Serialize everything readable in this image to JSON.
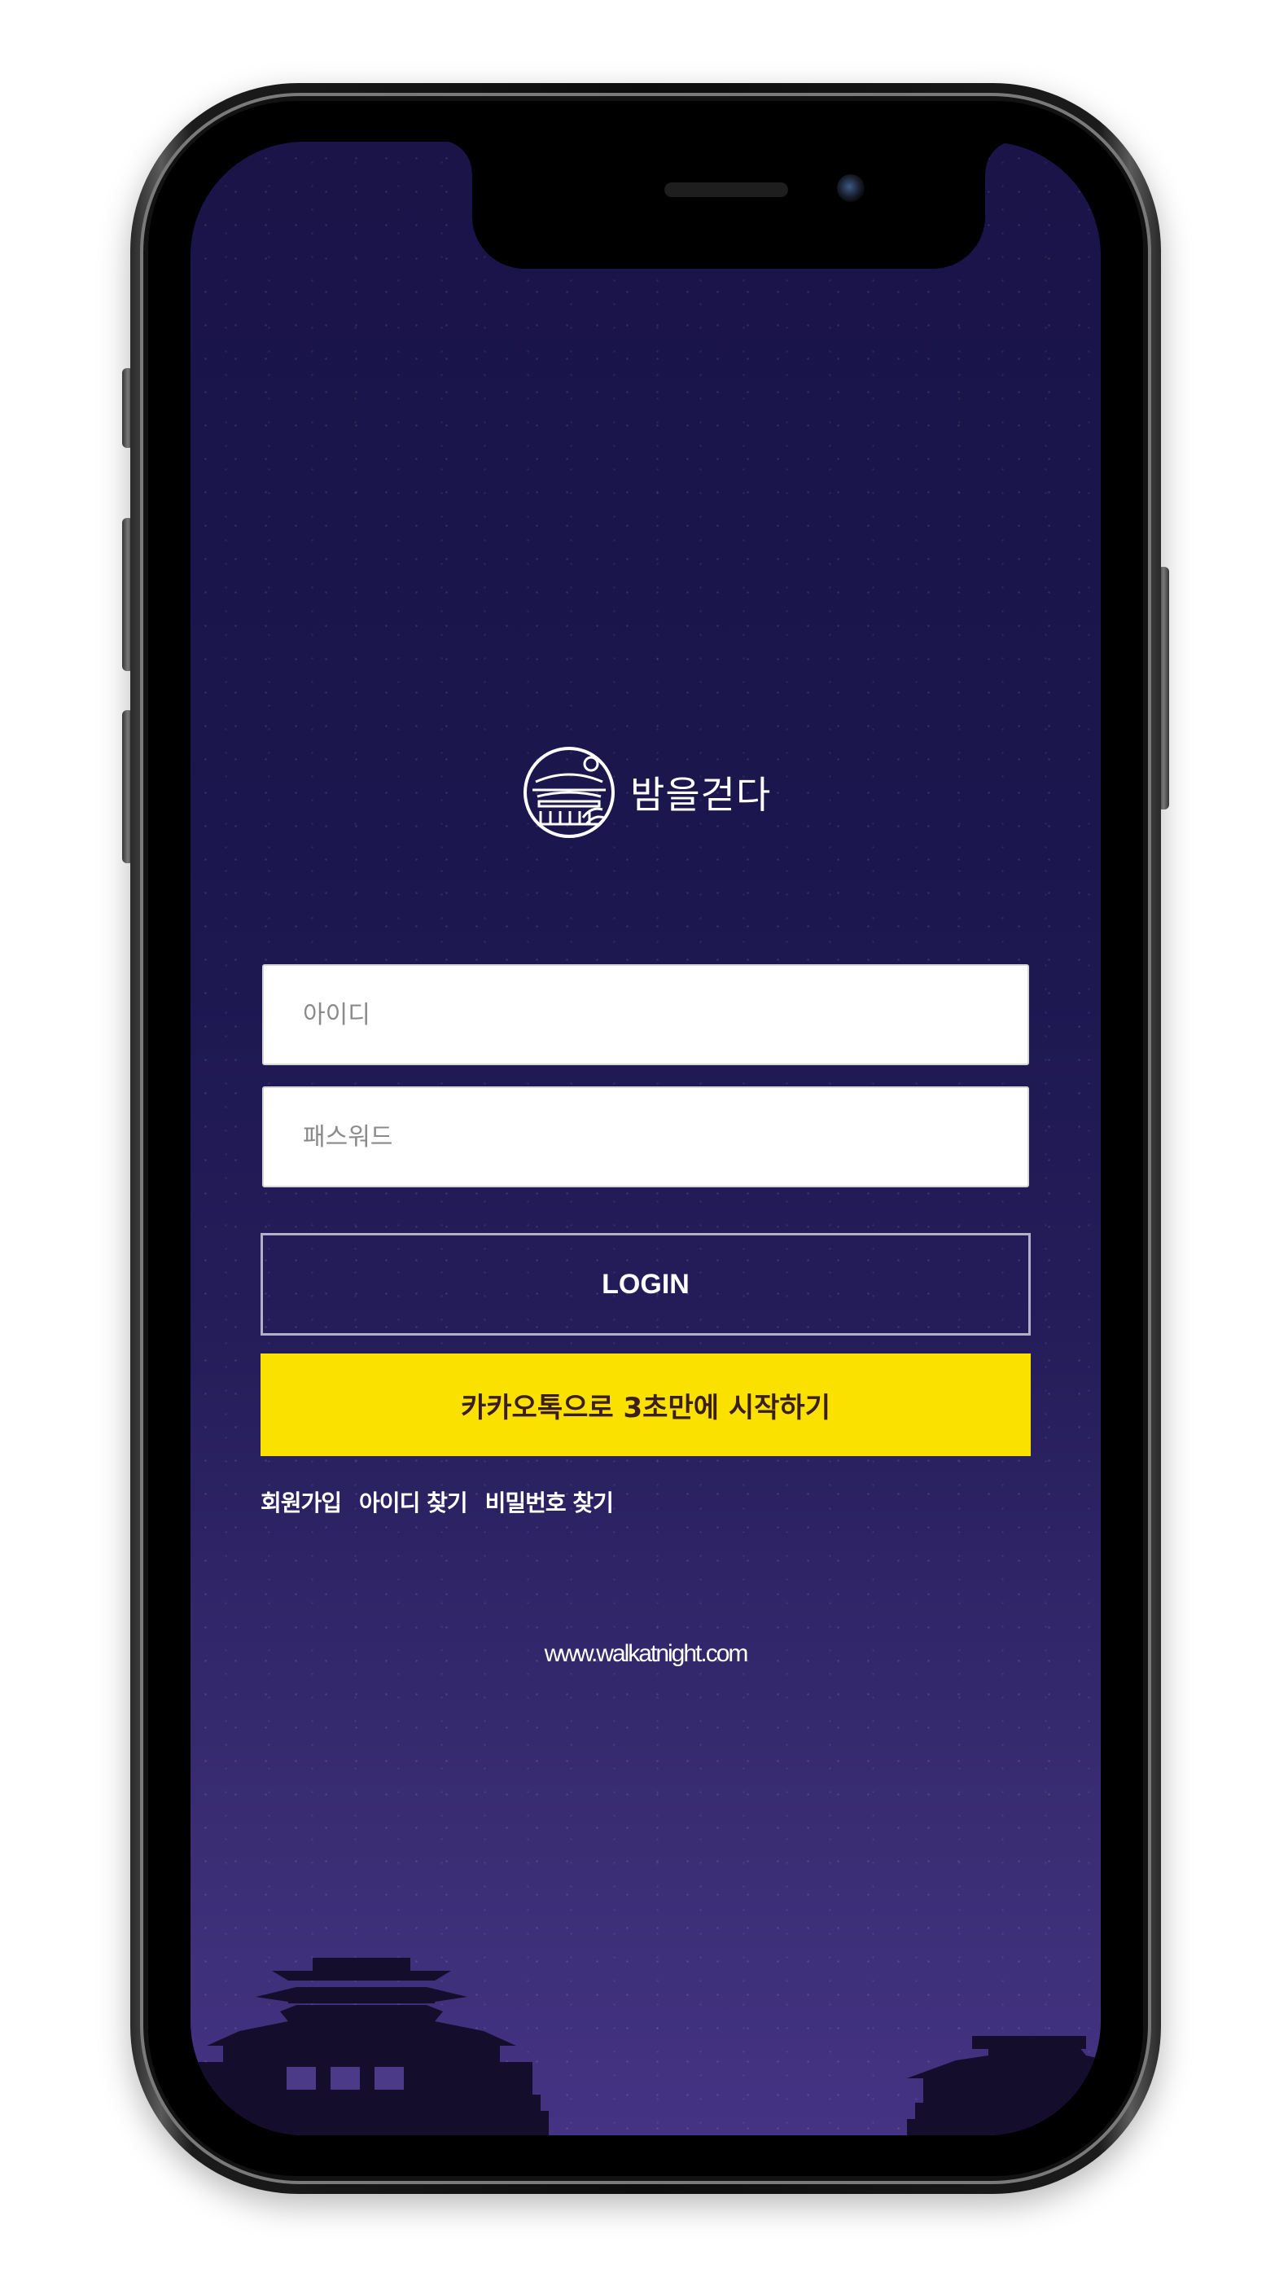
{
  "app": {
    "logo_text": "밤을걷다",
    "logo_icon": "night-palace-circle-icon"
  },
  "form": {
    "id_placeholder": "아이디",
    "password_placeholder": "패스워드",
    "login_label": "LOGIN",
    "kakao_label": "카카오톡으로 3초만에 시작하기"
  },
  "links": {
    "signup": "회원가입",
    "find_id": "아이디 찾기",
    "find_password": "비밀번호 찾기"
  },
  "footer": {
    "url": "www.walkatnight.com"
  },
  "colors": {
    "background_top": "#1a1449",
    "background_bottom": "#443383",
    "kakao_yellow": "#fae100",
    "skyline": "#140d2c"
  }
}
